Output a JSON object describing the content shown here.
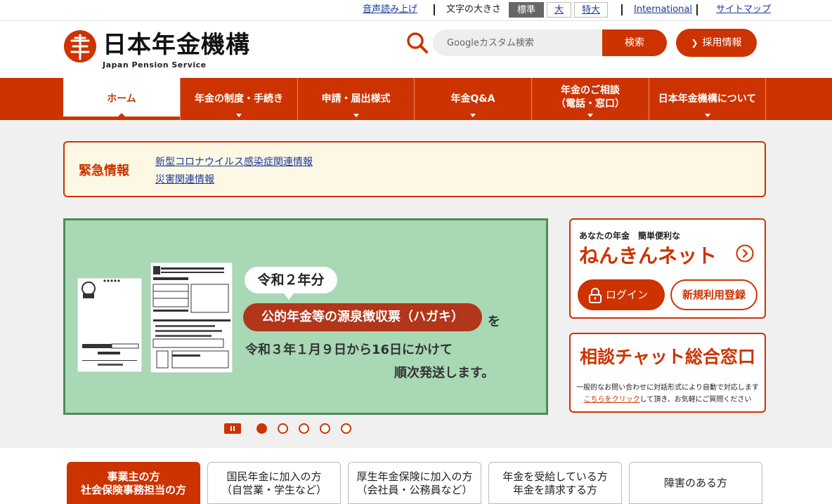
{
  "utility": {
    "voice": "音声読み上げ",
    "font_size_label": "文字の大きさ",
    "font_sizes": [
      "標準",
      "大",
      "特大"
    ],
    "font_size_selected": "標準",
    "international": "International",
    "sitemap": "サイトマップ"
  },
  "header": {
    "logo_text": "日本年金機構",
    "logo_sub": "Japan Pension Service",
    "search_placeholder": "Googleカスタム検索",
    "search_button": "検索",
    "recruit_button": "採用情報",
    "brand_color": "#cc3300"
  },
  "nav": [
    {
      "label": "ホーム",
      "active": true
    },
    {
      "label": "年金の制度・手続き"
    },
    {
      "label": "申請・届出様式"
    },
    {
      "label": "年金Q&A"
    },
    {
      "label": "年金のご相談\n（電話・窓口）"
    },
    {
      "label": "日本年金機構について"
    }
  ],
  "emergency": {
    "title": "緊急情報",
    "links": [
      "新型コロナウイルス感染症関連情報",
      "災害関連情報"
    ]
  },
  "banner": {
    "bubble": "令和２年分",
    "pill": "公的年金等の源泉徴収票（ハガキ）",
    "particle": "を",
    "line1": "令和３年１月９日から16日にかけて",
    "line2": "順次発送します。",
    "background_color": "#a8d8b4"
  },
  "carousel": {
    "slides": 5,
    "current": 1
  },
  "nenkin_net": {
    "subtitle": "あなたの年金　簡単便利な",
    "title": "ねんきんネット",
    "login": "ログイン",
    "register": "新規利用登録"
  },
  "chat": {
    "title": "相談チャット総合窓口",
    "desc1": "一般的なお問い合わせに対話形式により自動で対応します",
    "link": "こちらをクリック",
    "desc2_suffix": "して頂き、お気軽にご質問ください"
  },
  "audience_tabs": [
    {
      "label": "事業主の方\n社会保険事務担当の方",
      "active": true
    },
    {
      "label": "国民年金に加入の方\n（自営業・学生など）"
    },
    {
      "label": "厚生年金保険に加入の方\n（会社員・公務員など）"
    },
    {
      "label": "年金を受給している方\n年金を請求する方"
    },
    {
      "label": "障害のある方"
    }
  ]
}
